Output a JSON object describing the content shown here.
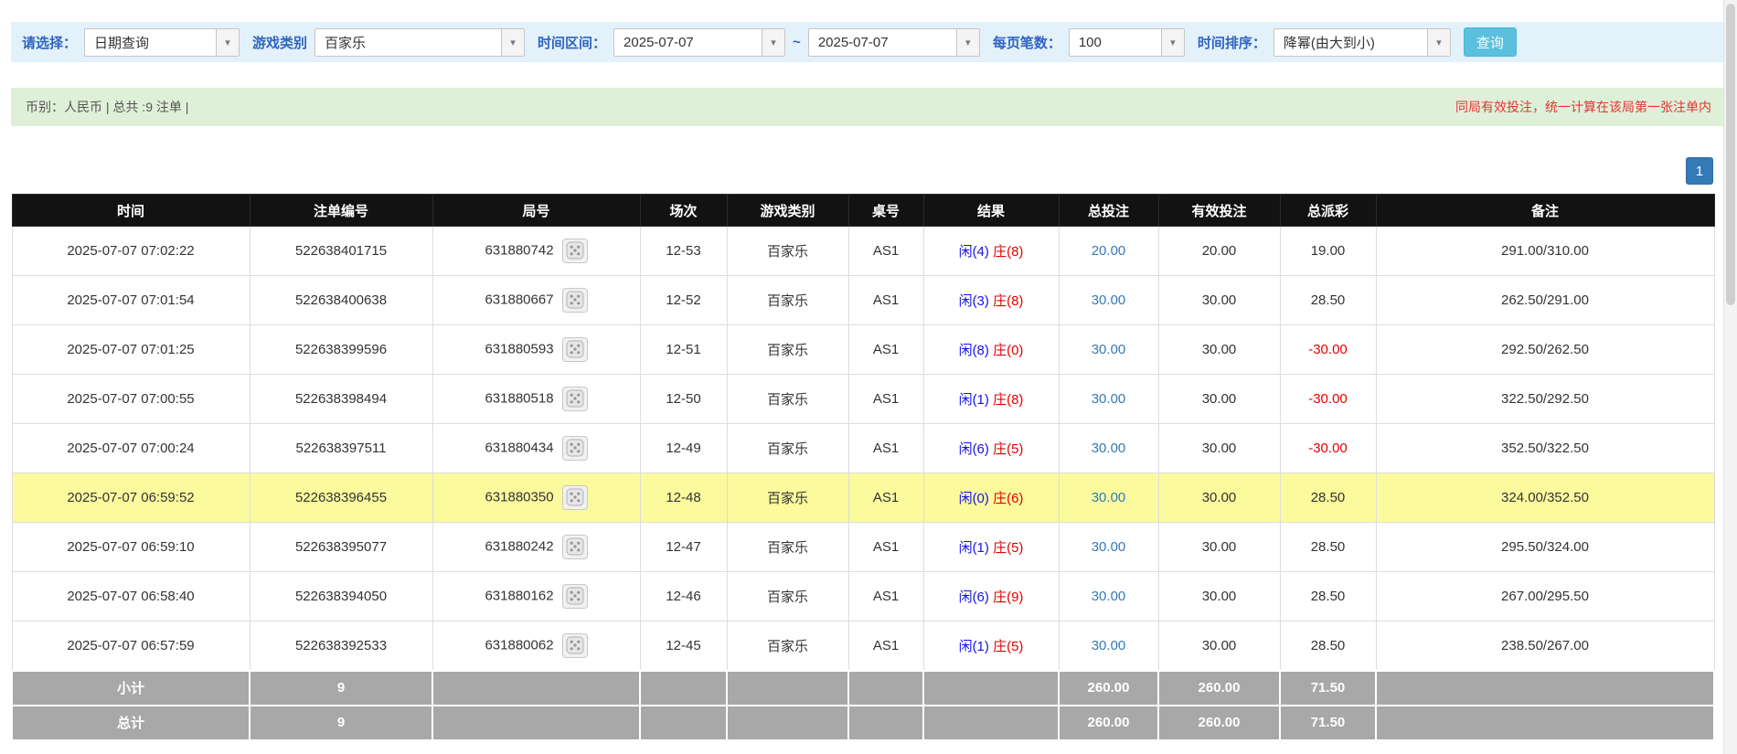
{
  "filters": {
    "select_label": "请选择：",
    "query_type": "日期查询",
    "game_category_label": "游戏类别",
    "game_category": "百家乐",
    "time_range_label": "时间区间：",
    "date_from": "2025-07-07",
    "tilde": "~",
    "date_to": "2025-07-07",
    "page_size_label": "每页笔数：",
    "page_size": "100",
    "sort_label": "时间排序：",
    "sort_value": "降幂(由大到小)",
    "search_button": "查询"
  },
  "summary": {
    "left": "币别：人民币 | 总共 :9 注单 |",
    "right": "同局有效投注，统一计算在该局第一张注单内"
  },
  "pagination": {
    "page": "1"
  },
  "table": {
    "headers": [
      "时间",
      "注单编号",
      "局号",
      "场次",
      "游戏类别",
      "桌号",
      "结果",
      "总投注",
      "有效投注",
      "总派彩",
      "备注"
    ],
    "rows": [
      {
        "time": "2025-07-07 07:02:22",
        "bet_id": "522638401715",
        "round_id": "631880742",
        "session": "12-53",
        "game": "百家乐",
        "table_no": "AS1",
        "result_player": "闲(4)",
        "result_banker": "庄(8)",
        "total_bet": "20.00",
        "valid_bet": "20.00",
        "payout": "19.00",
        "payout_negative": false,
        "note": "291.00/310.00",
        "highlight": false
      },
      {
        "time": "2025-07-07 07:01:54",
        "bet_id": "522638400638",
        "round_id": "631880667",
        "session": "12-52",
        "game": "百家乐",
        "table_no": "AS1",
        "result_player": "闲(3)",
        "result_banker": "庄(8)",
        "total_bet": "30.00",
        "valid_bet": "30.00",
        "payout": "28.50",
        "payout_negative": false,
        "note": "262.50/291.00",
        "highlight": false
      },
      {
        "time": "2025-07-07 07:01:25",
        "bet_id": "522638399596",
        "round_id": "631880593",
        "session": "12-51",
        "game": "百家乐",
        "table_no": "AS1",
        "result_player": "闲(8)",
        "result_banker": "庄(0)",
        "total_bet": "30.00",
        "valid_bet": "30.00",
        "payout": "-30.00",
        "payout_negative": true,
        "note": "292.50/262.50",
        "highlight": false
      },
      {
        "time": "2025-07-07 07:00:55",
        "bet_id": "522638398494",
        "round_id": "631880518",
        "session": "12-50",
        "game": "百家乐",
        "table_no": "AS1",
        "result_player": "闲(1)",
        "result_banker": "庄(8)",
        "total_bet": "30.00",
        "valid_bet": "30.00",
        "payout": "-30.00",
        "payout_negative": true,
        "note": "322.50/292.50",
        "highlight": false
      },
      {
        "time": "2025-07-07 07:00:24",
        "bet_id": "522638397511",
        "round_id": "631880434",
        "session": "12-49",
        "game": "百家乐",
        "table_no": "AS1",
        "result_player": "闲(6)",
        "result_banker": "庄(5)",
        "total_bet": "30.00",
        "valid_bet": "30.00",
        "payout": "-30.00",
        "payout_negative": true,
        "note": "352.50/322.50",
        "highlight": false
      },
      {
        "time": "2025-07-07 06:59:52",
        "bet_id": "522638396455",
        "round_id": "631880350",
        "session": "12-48",
        "game": "百家乐",
        "table_no": "AS1",
        "result_player": "闲(0)",
        "result_banker": "庄(6)",
        "total_bet": "30.00",
        "valid_bet": "30.00",
        "payout": "28.50",
        "payout_negative": false,
        "note": "324.00/352.50",
        "highlight": true
      },
      {
        "time": "2025-07-07 06:59:10",
        "bet_id": "522638395077",
        "round_id": "631880242",
        "session": "12-47",
        "game": "百家乐",
        "table_no": "AS1",
        "result_player": "闲(1)",
        "result_banker": "庄(5)",
        "total_bet": "30.00",
        "valid_bet": "30.00",
        "payout": "28.50",
        "payout_negative": false,
        "note": "295.50/324.00",
        "highlight": false
      },
      {
        "time": "2025-07-07 06:58:40",
        "bet_id": "522638394050",
        "round_id": "631880162",
        "session": "12-46",
        "game": "百家乐",
        "table_no": "AS1",
        "result_player": "闲(6)",
        "result_banker": "庄(9)",
        "total_bet": "30.00",
        "valid_bet": "30.00",
        "payout": "28.50",
        "payout_negative": false,
        "note": "267.00/295.50",
        "highlight": false
      },
      {
        "time": "2025-07-07 06:57:59",
        "bet_id": "522638392533",
        "round_id": "631880062",
        "session": "12-45",
        "game": "百家乐",
        "table_no": "AS1",
        "result_player": "闲(1)",
        "result_banker": "庄(5)",
        "total_bet": "30.00",
        "valid_bet": "30.00",
        "payout": "28.50",
        "payout_negative": false,
        "note": "238.50/267.00",
        "highlight": false
      }
    ],
    "footer": [
      {
        "label": "小计",
        "count": "9",
        "total_bet": "260.00",
        "valid_bet": "260.00",
        "payout": "71.50"
      },
      {
        "label": "总计",
        "count": "9",
        "total_bet": "260.00",
        "valid_bet": "260.00",
        "payout": "71.50"
      }
    ]
  }
}
